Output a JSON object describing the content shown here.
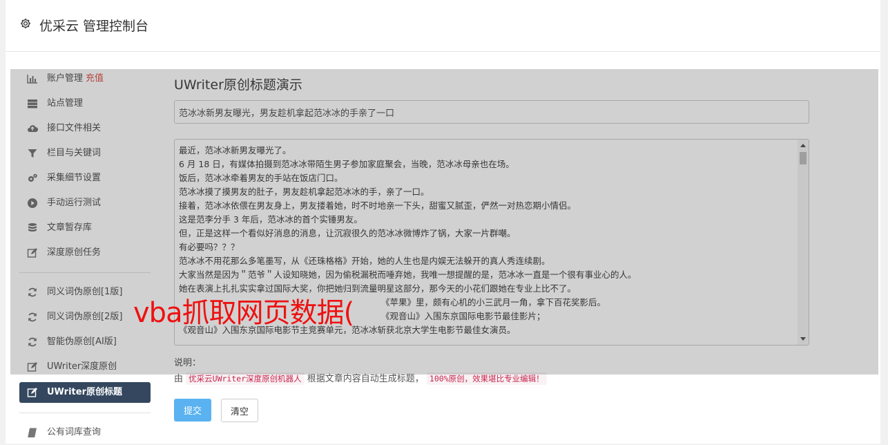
{
  "header": {
    "title": "优采云 管理控制台"
  },
  "sidebar": {
    "items": [
      {
        "label": "账户管理",
        "badge": "充值"
      },
      {
        "label": "站点管理"
      },
      {
        "label": "接口文件相关"
      },
      {
        "label": "栏目与关键词"
      },
      {
        "label": "采集细节设置"
      },
      {
        "label": "手动运行测试"
      },
      {
        "label": "文章暂存库"
      },
      {
        "label": "深度原创任务"
      },
      {
        "label": "同义词伪原创[1版]"
      },
      {
        "label": "同义词伪原创[2版]"
      },
      {
        "label": "智能伪原创[AI版]"
      },
      {
        "label": "UWriter深度原创"
      },
      {
        "label": "UWriter原创标题"
      },
      {
        "label": "公有词库查询"
      }
    ]
  },
  "main": {
    "page_title": "UWriter原创标题演示",
    "title_value": "范冰冰新男友曝光，男友趁机拿起范冰冰的手亲了一口",
    "article_lines": [
      "最近，范冰冰新男友曝光了。",
      "6 月 18 日，有媒体拍摄到范冰冰带陌生男子参加家庭聚会，当晚，范冰冰母亲也在场。",
      "饭后，范冰冰牵着男友的手站在饭店门口。",
      "范冰冰摸了摸男友的肚子，男友趁机拿起范冰冰的手，亲了一口。",
      "接着，范冰冰依偎在男友身上，男友搂着她，时不时地亲一下头，甜蜜又腻歪，俨然一对热恋期小情侣。",
      "这是范李分手 3 年后，范冰冰的首个实锤男友。",
      "但，正是这样一个看似好消息的消息，让沉寂很久的范冰冰微博炸了锅，大家一片群嘲。",
      "有必要吗？？？",
      "范冰冰不用花那么多笔墨写，从《还珠格格》开始，她的人生也是内娱无法躲开的真人秀连续剧。",
      "大家当然是因为＂范爷＂人设知晓她，因为偷税漏税而唾弃她，我唯一想提醒的是，范冰冰一直是一个很有事业心的人。",
      "她在表演上扎扎实实拿过国际大奖，你把她归到流量明星这部分，那今天的小花们跟她在专业上比不了。",
      "《苹果》里，颇有心机的小三武月一角，拿下百花奖影后。",
      "《观音山》入围东京国际电影节最佳影片；",
      "《观音山》入围东京国际电影节主竞赛单元，范冰冰斩获北京大学生电影节最佳女演员。"
    ],
    "note_label": "说明：",
    "note_prefix": "由",
    "note_code1": "优采云UWriter深度原创机器人",
    "note_middle": "根据文章内容自动生成标题，",
    "note_code2": "100%原创，效果堪比专业编辑！",
    "submit_label": "提交",
    "clear_label": "清空"
  },
  "watermark": "vba抓取网页数据(",
  "icons": [
    "gear-icon",
    "bar-chart-icon",
    "server-icon",
    "cloud-upload-icon",
    "filter-icon",
    "cogs-icon",
    "play-circle-icon",
    "database-icon",
    "edit-icon",
    "refresh-icon",
    "book-icon"
  ]
}
